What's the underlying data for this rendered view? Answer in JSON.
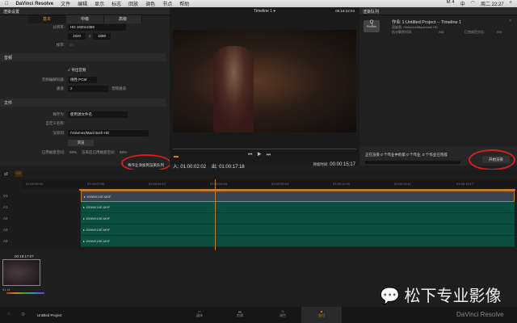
{
  "menubar": {
    "app": "DaVinci Resolve",
    "items": [
      "文件",
      "编辑",
      "显示",
      "标志",
      "回放",
      "调色",
      "节点",
      "帮助"
    ],
    "status": [
      "M 4",
      "中",
      "周二 22:27"
    ]
  },
  "render_settings": {
    "title": "渲染设置",
    "tabs": [
      "基本",
      "中级",
      "高级"
    ],
    "resolution_label": "分辨率:",
    "resolution": "HD 1920x1080",
    "width": "1920",
    "x": "x",
    "height": "1080",
    "fps_label": "帧率:",
    "fps": "25",
    "audio_section": "音频",
    "export_audio": "导出音频",
    "audio_codec_label": "音频编解码器:",
    "audio_codec": "线性 PCM",
    "channels_label": "通道:",
    "channels": "2",
    "channels_suffix": "音频通道",
    "file_section": "文件",
    "save_as_label": "保存为:",
    "save_as": "使用源文件名",
    "custom_name_label": "自定义名称:",
    "render_to_label": "渲染到:",
    "render_to": "/Volumes/Macintosh HD",
    "browse": "浏览",
    "disk_used_label": "已用磁盘空间:",
    "disk_used": "98%",
    "disk_after_label": "渲染后已用磁盘空间:",
    "disk_after": "98%",
    "add_to_queue": "将作业添加到渲染队列"
  },
  "viewer": {
    "title": "Timeline 1",
    "timecode": "00:18:22:04",
    "in_label": "入:",
    "in": "01:00:02:02",
    "out_label": "出:",
    "out": "01:00:17:18",
    "duration_label": "持续时间:",
    "duration": "00:00:15:17"
  },
  "render_queue": {
    "title": "渲染队列",
    "job_title": "作业 1:Untitled Project -- Timeline 1",
    "badge": "Q",
    "badge_sub": "ProRes",
    "path_label": "渲染到:",
    "path": "/Volumes/Macintosh HD",
    "time_label": "估计剩余时间:",
    "time": "N/A",
    "progress_label": "已完成百分比:",
    "progress": "0%",
    "status": "正在渲染 0 个作业中的第 0 个作业, 0 个作业已完成",
    "start_render": "开始渲染"
  },
  "timeline": {
    "ticks": [
      "01:00:00:00",
      "01:00:02:06",
      "01:00:04:12",
      "01:00:06:18",
      "01:00:08:24",
      "01:00:11:05",
      "01:00:13:11",
      "01:00:15:17"
    ],
    "tracks": [
      {
        "name": "V1",
        "clip": "150WK1XE.MXF"
      },
      {
        "name": "A1",
        "clip": "150WK1XE.MXF"
      },
      {
        "name": "A2",
        "clip": "150WK1XE.MXF"
      },
      {
        "name": "A3",
        "clip": "150WK1XE.MXF"
      },
      {
        "name": "A4",
        "clip": "150WK1XE.MXF"
      }
    ]
  },
  "thumb": {
    "timecode": "00:18:17:07",
    "label": "01  v1"
  },
  "bottom": {
    "project": "Untitled Project",
    "pages": [
      "媒体",
      "剪辑",
      "调色",
      "交付"
    ],
    "brand": "DaVinci Resolve",
    "watermark": "松下专业影像"
  },
  "colors": {
    "accent": "#e08a2b",
    "audio_clip": "#0c4e3e",
    "annotation": "#d21f1f"
  }
}
